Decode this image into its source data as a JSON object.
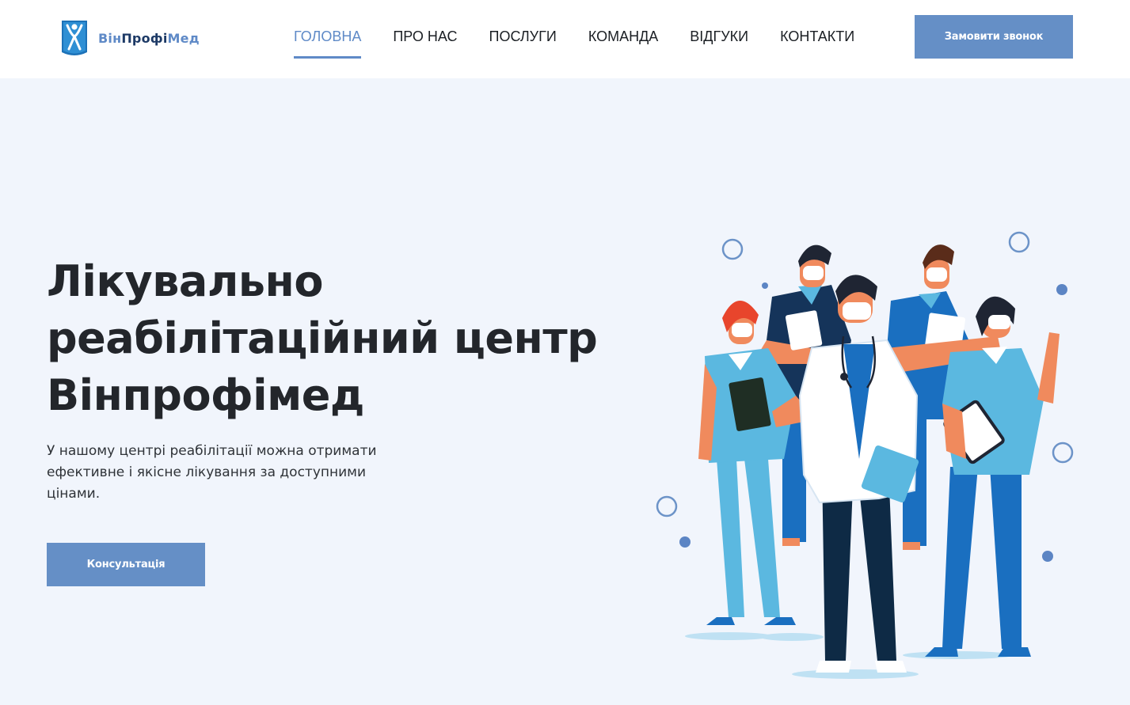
{
  "brand": {
    "name_part1": "Він",
    "name_part2": "Профі",
    "name_part3": "Мед",
    "logo_icon": "human-figure-shield-icon"
  },
  "nav": {
    "items": [
      {
        "label": "ГОЛОВНА",
        "active": true
      },
      {
        "label": "ПРО НАС",
        "active": false
      },
      {
        "label": "ПОСЛУГИ",
        "active": false
      },
      {
        "label": "КОМАНДА",
        "active": false
      },
      {
        "label": "ВІДГУКИ",
        "active": false
      },
      {
        "label": "КОНТАКТИ",
        "active": false
      }
    ]
  },
  "header": {
    "call_button": "Замовити звонок"
  },
  "hero": {
    "title_line1": "Лікувально",
    "title_line2": "реабілітаційний центр",
    "title_line3": "Вінпрофімед",
    "text": "У нашому центрі реабілітації можна отримати ефективне і якісне лікування за доступними цінами.",
    "consult_button": "Консультація",
    "illustration": "medical-team-illustration"
  },
  "colors": {
    "accent": "#658fc6",
    "nav_active": "#5f8ac7",
    "background": "#f1f5fc",
    "header_bg": "#ffffff",
    "title": "#23262b",
    "scrub_light": "#5bb8e0",
    "scrub_dark": "#1a6fc0",
    "navy": "#0e2a45"
  }
}
